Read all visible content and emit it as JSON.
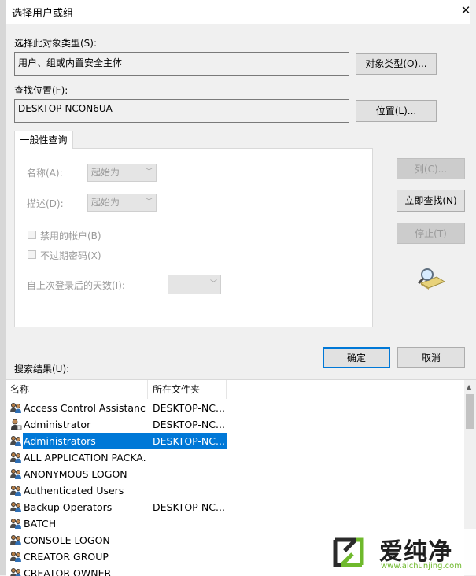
{
  "dialog": {
    "title": "选择用户或组",
    "close_glyph": "✕"
  },
  "object_type": {
    "label": "选择此对象类型(S):",
    "value": "用户、组或内置安全主体",
    "button": "对象类型(O)..."
  },
  "location": {
    "label": "查找位置(F):",
    "value": "DESKTOP-NCON6UA",
    "button": "位置(L)..."
  },
  "query": {
    "tab": "一般性查询",
    "name_label": "名称(A):",
    "name_combo": "起始为",
    "desc_label": "描述(D):",
    "desc_combo": "起始为",
    "disabled_accounts": "禁用的帐户(B)",
    "non_expiring_pw": "不过期密码(X)",
    "days_label": "自上次登录后的天数(I):"
  },
  "side_buttons": {
    "columns": "列(C)...",
    "find_now": "立即查找(N)",
    "stop": "停止(T)"
  },
  "footer": {
    "ok": "确定",
    "cancel": "取消",
    "results_label": "搜索结果(U):"
  },
  "results": {
    "columns": [
      "名称",
      "所在文件夹"
    ],
    "rows": [
      {
        "name": "Access Control Assistanc...",
        "folder": "DESKTOP-NC...",
        "icon": "group-icon"
      },
      {
        "name": "Administrator",
        "folder": "DESKTOP-NC...",
        "icon": "user-icon"
      },
      {
        "name": "Administrators",
        "folder": "DESKTOP-NC...",
        "icon": "group-icon",
        "selected": true
      },
      {
        "name": "ALL APPLICATION PACKA...",
        "folder": "",
        "icon": "group-icon"
      },
      {
        "name": "ANONYMOUS LOGON",
        "folder": "",
        "icon": "group-icon"
      },
      {
        "name": "Authenticated Users",
        "folder": "",
        "icon": "group-icon"
      },
      {
        "name": "Backup Operators",
        "folder": "DESKTOP-NC...",
        "icon": "group-icon"
      },
      {
        "name": "BATCH",
        "folder": "",
        "icon": "group-icon"
      },
      {
        "name": "CONSOLE LOGON",
        "folder": "",
        "icon": "group-icon"
      },
      {
        "name": "CREATOR GROUP",
        "folder": "",
        "icon": "group-icon"
      },
      {
        "name": "CREATOR OWNER",
        "folder": "",
        "icon": "group-icon"
      }
    ]
  },
  "watermark": {
    "brand": "爱纯净",
    "url": "www.aichunjing.com"
  },
  "colors": {
    "selection": "#0078d7",
    "brand_green": "#6fb92c"
  }
}
